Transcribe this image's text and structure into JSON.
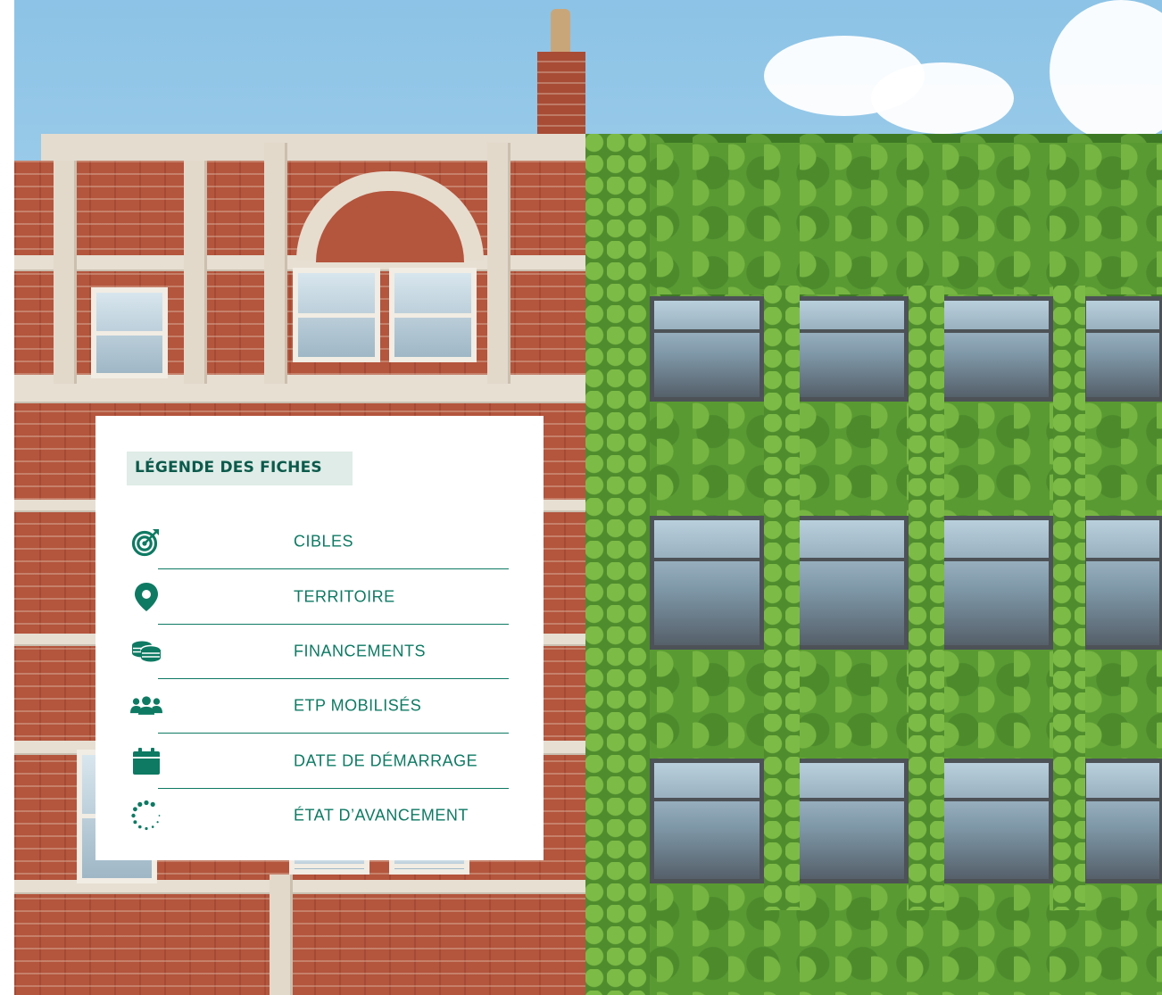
{
  "legend": {
    "title": "LÉGENDE DES FICHES",
    "accent_color": "#0e7a63",
    "title_color": "#0b5a4b",
    "title_background": "#dfece7",
    "items": [
      {
        "icon": "target-icon",
        "label": "CIBLES"
      },
      {
        "icon": "map-pin-icon",
        "label": "TERRITOIRE"
      },
      {
        "icon": "coins-icon",
        "label": "FINANCEMENTS"
      },
      {
        "icon": "people-icon",
        "label": "ETP MOBILISÉS"
      },
      {
        "icon": "calendar-icon",
        "label": "DATE DE DÉMARRAGE"
      },
      {
        "icon": "progress-spinner-icon",
        "label": "ÉTAT D’AVANCEMENT"
      }
    ]
  },
  "photo": {
    "subject": "brick-building-and-green-wall-building"
  }
}
